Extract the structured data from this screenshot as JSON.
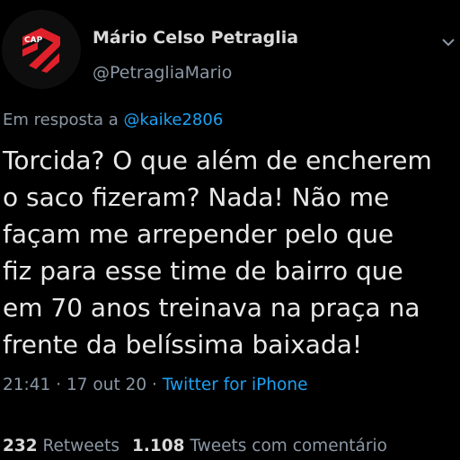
{
  "author": {
    "display_name": "Mário Celso Petraglia",
    "handle": "@PetragliaMario",
    "avatar_icon": "club-crest-icon",
    "avatar_colors": {
      "background": "#0e0e0e",
      "crest": "#e0212b"
    }
  },
  "reply": {
    "prefix": "Em resposta a",
    "mention": "@kaike2806"
  },
  "tweet": {
    "text": "Torcida? O que além de encherem\no saco fizeram? Nada! Não me\nfaçam me arrepender pelo que\nfiz para esse time de bairro que\nem 70 anos treinava na praça na\nfrente da belíssima baixada!"
  },
  "meta": {
    "time": "21:41",
    "separator": "·",
    "date": "17 out 20",
    "source": "Twitter for iPhone"
  },
  "stats": {
    "retweets_count": "232",
    "retweets_label": "Retweets",
    "quote_count": "1.108",
    "quote_label": "Tweets com comentário"
  },
  "colors": {
    "background": "#000000",
    "text": "#e8e8e8",
    "secondary": "#8b98a5",
    "link": "#1da1f2"
  }
}
